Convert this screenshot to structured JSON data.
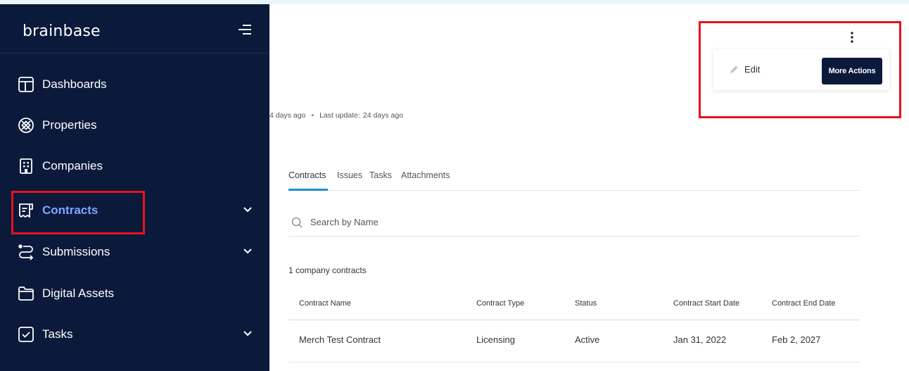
{
  "app": {
    "logo_text": "brainbase"
  },
  "sidebar": {
    "items": [
      {
        "label": "Dashboards",
        "icon": "dashboard-icon",
        "active": false,
        "expandable": false
      },
      {
        "label": "Properties",
        "icon": "properties-icon",
        "active": false,
        "expandable": false
      },
      {
        "label": "Companies",
        "icon": "building-icon",
        "active": false,
        "expandable": false
      },
      {
        "label": "Contracts",
        "icon": "contract-icon",
        "active": true,
        "expandable": true
      },
      {
        "label": "Submissions",
        "icon": "submissions-icon",
        "active": false,
        "expandable": true
      },
      {
        "label": "Digital Assets",
        "icon": "folder-icon",
        "active": false,
        "expandable": false
      },
      {
        "label": "Tasks",
        "icon": "task-checkbox-icon",
        "active": false,
        "expandable": true
      }
    ]
  },
  "header": {
    "actions": {
      "edit_label": "Edit",
      "more_actions_label": "More Actions"
    },
    "meta": {
      "created_fragment": "4 days ago",
      "last_update_label": "Last update:",
      "last_update_value": "24 days ago"
    }
  },
  "tabs": [
    {
      "label": "Contracts",
      "active": true
    },
    {
      "label": "Issues",
      "active": false
    },
    {
      "label": "Tasks",
      "active": false
    },
    {
      "label": "Attachments",
      "active": false
    }
  ],
  "search": {
    "placeholder": "Search by Name",
    "value": ""
  },
  "contracts": {
    "count_label": "1 company contracts",
    "columns": [
      "Contract Name",
      "Contract Type",
      "Status",
      "Contract Start Date",
      "Contract End Date"
    ],
    "rows": [
      [
        "Merch Test Contract",
        "Licensing",
        "Active",
        "Jan 31, 2022",
        "Feb 2, 2027"
      ]
    ]
  },
  "colors": {
    "sidebar_bg": "#0b1a3b",
    "active_nav": "#7fa6ff",
    "accent_tab": "#1f8cd6",
    "highlight_box": "#e8121b",
    "primary_button": "#0b1a3b"
  }
}
